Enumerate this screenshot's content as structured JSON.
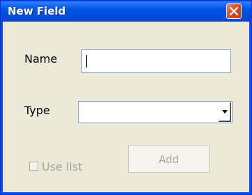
{
  "window": {
    "title": "New Field"
  },
  "form": {
    "name_label": "Name",
    "name_value": "",
    "type_label": "Type",
    "type_value": "",
    "use_list_label": "Use list",
    "use_list_checked": false,
    "use_list_enabled": false,
    "add_label": "Add",
    "add_enabled": false
  },
  "icons": {
    "close": "close-icon",
    "dropdown": "chevron-down-icon"
  },
  "colors": {
    "titlebar": "#0054e3",
    "client_background": "#ece9d8",
    "close_button": "#d8502c",
    "disabled_text": "#aca899"
  }
}
